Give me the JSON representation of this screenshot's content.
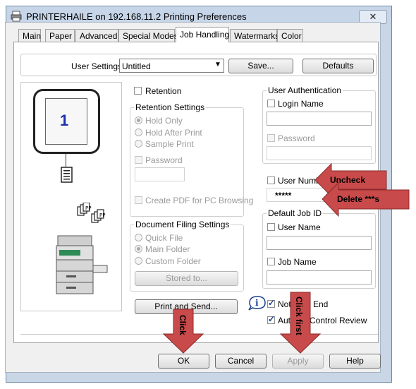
{
  "window": {
    "title": "PRINTERHAILE on 192.168.11.2 Printing Preferences",
    "close_glyph": "✕",
    "printer_icon": "printer-icon"
  },
  "tabs": [
    {
      "label": "Main"
    },
    {
      "label": "Paper"
    },
    {
      "label": "Advanced"
    },
    {
      "label": "Special Modes"
    },
    {
      "label": "Job Handling"
    },
    {
      "label": "Watermarks"
    },
    {
      "label": "Color"
    }
  ],
  "active_tab": "Job Handling",
  "user_settings": {
    "label": "User Settings:",
    "value": "Untitled",
    "save_label": "Save...",
    "defaults_label": "Defaults"
  },
  "preview": {
    "page_number": "1"
  },
  "retention": {
    "label": "Retention",
    "checked": false,
    "settings_group": "Retention Settings",
    "options": [
      "Hold Only",
      "Hold After Print",
      "Sample Print"
    ],
    "selected": "Hold Only",
    "password_label": "Password",
    "create_pdf_label": "Create PDF for PC Browsing"
  },
  "document_filing": {
    "group": "Document Filing Settings",
    "options": [
      "Quick File",
      "Main Folder",
      "Custom Folder"
    ],
    "selected": "Main Folder",
    "stored_to_label": "Stored to..."
  },
  "print_and_send_label": "Print and Send...",
  "user_authentication": {
    "group": "User Authentication",
    "login_name_label": "Login Name",
    "password_label": "Password"
  },
  "user_number": {
    "label": "User Numb",
    "value": "*****",
    "checked": false
  },
  "default_job_id": {
    "group": "Default Job ID",
    "user_name_label": "User Name",
    "job_name_label": "Job Name"
  },
  "notify_job_end": {
    "label_left": "Not",
    "label_right": "End",
    "checked": true
  },
  "auto_job_control": {
    "label_left": "Aut",
    "label_right": "Control Review",
    "checked": true
  },
  "info_icon": "info-icon",
  "annotations": {
    "uncheck": "Uncheck",
    "delete": "Delete ***s",
    "click_first": "Click first",
    "click": "Click",
    "color": "#c94a4a"
  },
  "footer": {
    "ok_label": "OK",
    "cancel_label": "Cancel",
    "apply_label": "Apply",
    "help_label": "Help"
  }
}
